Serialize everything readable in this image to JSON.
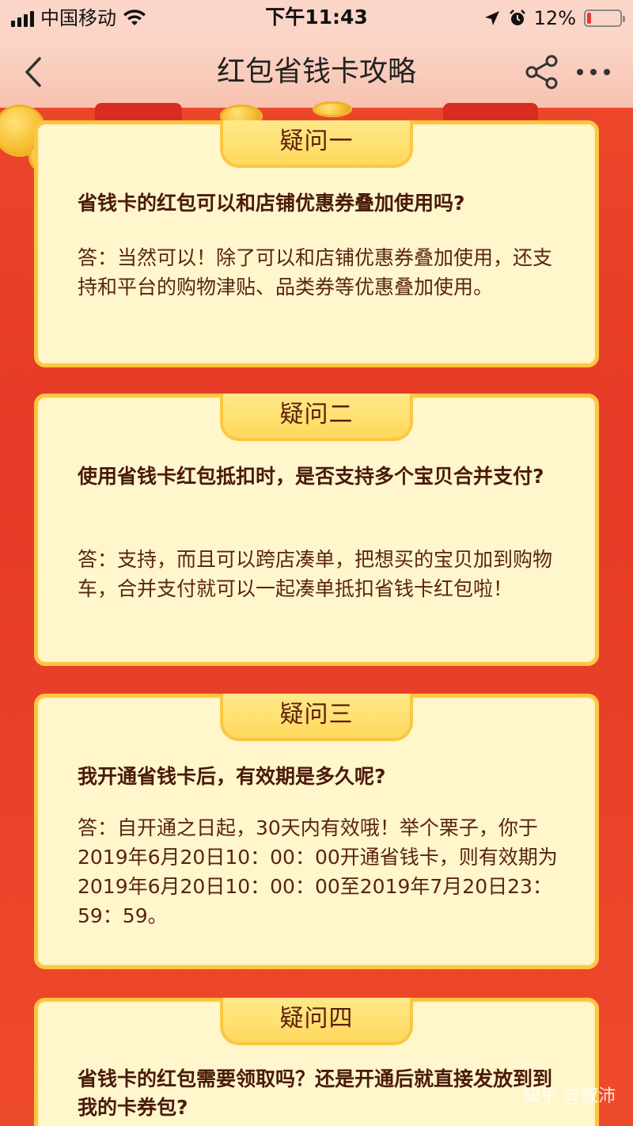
{
  "status_bar": {
    "carrier": "中国移动",
    "time": "下午11:43",
    "battery_percent": "12%",
    "battery_level": 0.12
  },
  "nav": {
    "title": "红包省钱卡攻略",
    "icons": [
      "back-chevron-icon",
      "share-icon",
      "more-icon"
    ]
  },
  "faq": [
    {
      "tab": "疑问一",
      "question": "省钱卡的红包可以和店铺优惠券叠加使用吗?",
      "answer": "答：当然可以！除了可以和店铺优惠券叠加使用，还支持和平台的购物津贴、品类券等优惠叠加使用。"
    },
    {
      "tab": "疑问二",
      "question": "使用省钱卡红包抵扣时，是否支持多个宝贝合并支付?",
      "answer": "答：支持，而且可以跨店凑单，把想买的宝贝加到购物车，合并支付就可以一起凑单抵扣省钱卡红包啦！"
    },
    {
      "tab": "疑问三",
      "question": "我开通省钱卡后，有效期是多久呢?",
      "answer": "答：自开通之日起，30天内有效哦！举个栗子，你于2019年6月20日10：00：00开通省钱卡，则有效期为2019年6月20日10：00：00至2019年7月20日23：59：59。"
    },
    {
      "tab": "疑问四",
      "question": "省钱卡的红包需要领取吗？还是开通后就直接发放到到我的卡券包?",
      "answer": ""
    }
  ],
  "watermark": "知乎 @叙沛",
  "colors": {
    "background": "#e53a26",
    "card_bg": "#fff6cc",
    "card_border": "#fbc743",
    "text_dark": "#4a1a0a"
  }
}
